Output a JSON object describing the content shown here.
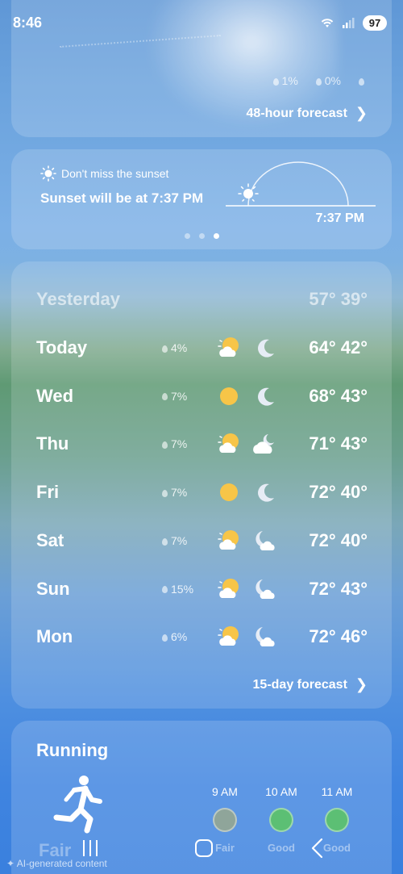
{
  "status": {
    "time": "8:46",
    "battery": "97"
  },
  "hourly": {
    "precip": [
      "1%",
      "0%"
    ],
    "link_label": "48-hour forecast"
  },
  "sunset": {
    "kicker": "Don't miss the sunset",
    "title": "Sunset will be at 7:37 PM",
    "time": "7:37 PM",
    "page_count": 3,
    "active_page": 3
  },
  "forecast": {
    "yesterday": {
      "name": "Yesterday",
      "temps": "57° 39°"
    },
    "days": [
      {
        "name": "Today",
        "precip": "4%",
        "day_icon": "partly-sunny-icon",
        "night_icon": "moon-icon",
        "temps": "64° 42°"
      },
      {
        "name": "Wed",
        "precip": "7%",
        "day_icon": "sun-icon",
        "night_icon": "moon-icon",
        "temps": "68° 43°"
      },
      {
        "name": "Thu",
        "precip": "7%",
        "day_icon": "partly-sunny-icon",
        "night_icon": "cloudy-night-icon",
        "temps": "71° 43°"
      },
      {
        "name": "Fri",
        "precip": "7%",
        "day_icon": "sun-icon",
        "night_icon": "moon-icon",
        "temps": "72° 40°"
      },
      {
        "name": "Sat",
        "precip": "7%",
        "day_icon": "partly-sunny-icon",
        "night_icon": "partly-cloudy-night-icon",
        "temps": "72° 40°"
      },
      {
        "name": "Sun",
        "precip": "15%",
        "day_icon": "partly-sunny-icon",
        "night_icon": "partly-cloudy-night-icon",
        "temps": "72° 43°"
      },
      {
        "name": "Mon",
        "precip": "6%",
        "day_icon": "partly-sunny-icon",
        "night_icon": "partly-cloudy-night-icon",
        "temps": "72° 46°"
      }
    ],
    "link_label": "15-day forecast"
  },
  "running": {
    "title": "Running",
    "current": "Fair",
    "slots": [
      {
        "time": "9 AM",
        "rating": "Fair"
      },
      {
        "time": "10 AM",
        "rating": "Good"
      },
      {
        "time": "11 AM",
        "rating": "Good"
      }
    ]
  },
  "footer": {
    "ai_note": "AI-generated content"
  },
  "colors": {
    "fair": "#8fa59a",
    "good": "#5cbf74",
    "sun": "#f7c548"
  }
}
